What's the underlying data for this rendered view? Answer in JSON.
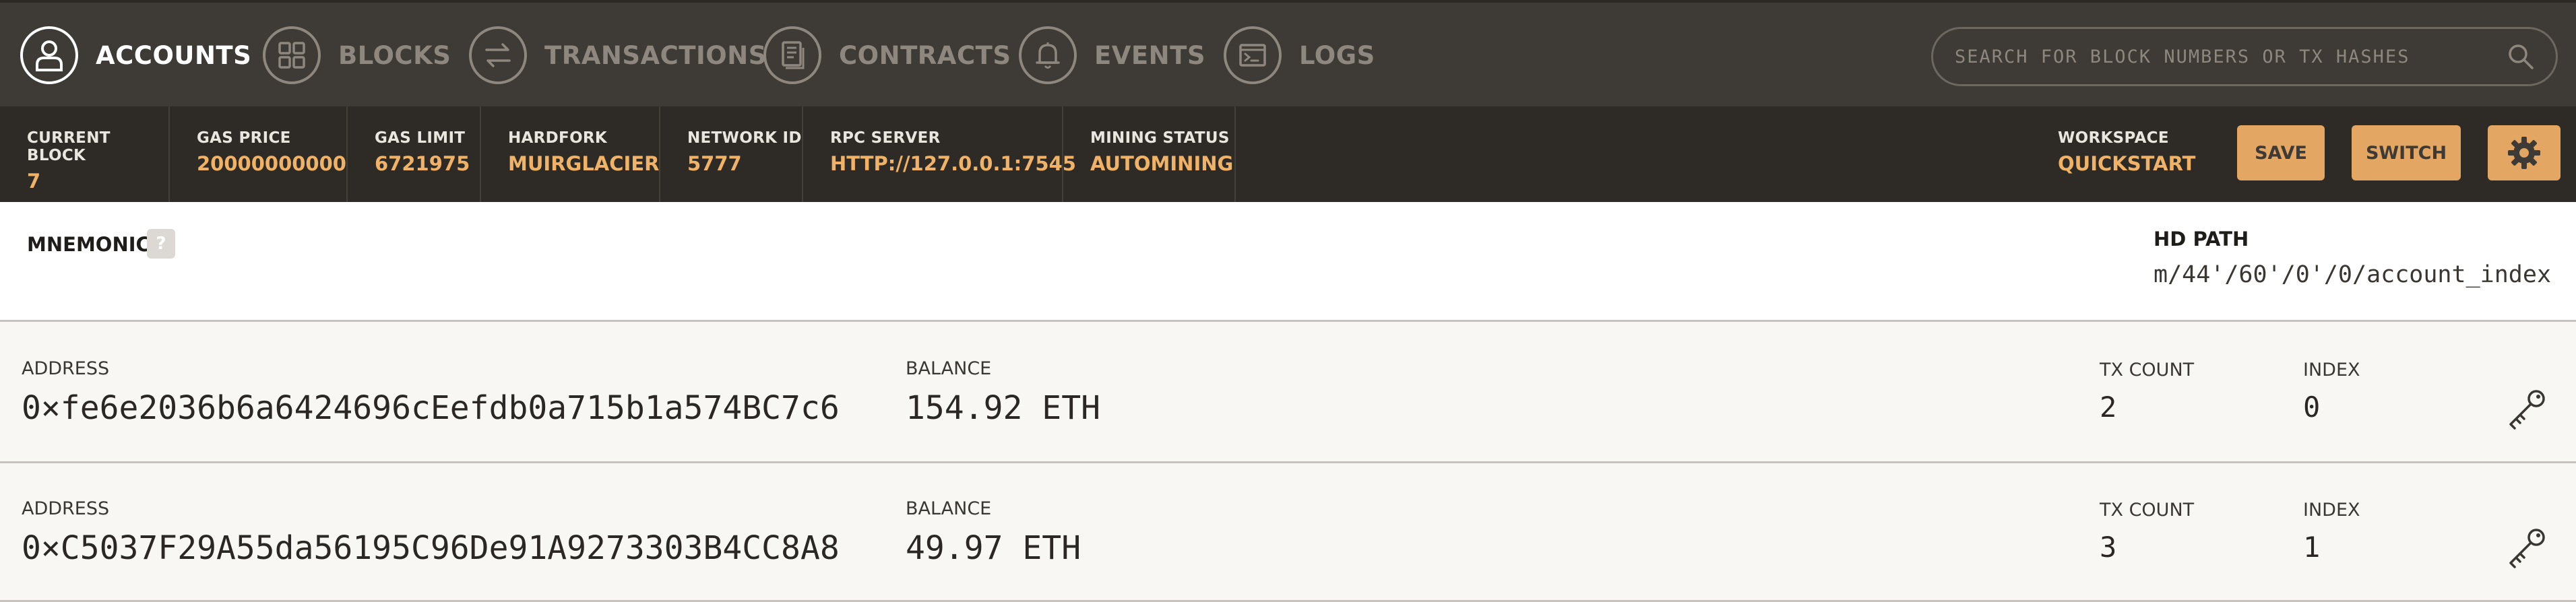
{
  "nav": {
    "items": [
      {
        "label": "ACCOUNTS",
        "icon": "user-icon",
        "active": true
      },
      {
        "label": "BLOCKS",
        "icon": "blocks-icon",
        "active": false
      },
      {
        "label": "TRANSACTIONS",
        "icon": "transfer-icon",
        "active": false
      },
      {
        "label": "CONTRACTS",
        "icon": "document-icon",
        "active": false
      },
      {
        "label": "EVENTS",
        "icon": "bell-icon",
        "active": false
      },
      {
        "label": "LOGS",
        "icon": "terminal-icon",
        "active": false
      }
    ],
    "search_placeholder": "SEARCH FOR BLOCK NUMBERS OR TX HASHES"
  },
  "status": {
    "current_block": {
      "label": "CURRENT BLOCK",
      "value": "7"
    },
    "gas_price": {
      "label": "GAS PRICE",
      "value": "20000000000"
    },
    "gas_limit": {
      "label": "GAS LIMIT",
      "value": "6721975"
    },
    "hardfork": {
      "label": "HARDFORK",
      "value": "MUIRGLACIER"
    },
    "network_id": {
      "label": "NETWORK ID",
      "value": "5777"
    },
    "rpc_server": {
      "label": "RPC SERVER",
      "value": "HTTP://127.0.0.1:7545"
    },
    "mining_status": {
      "label": "MINING STATUS",
      "value": "AUTOMINING"
    },
    "workspace": {
      "label": "WORKSPACE",
      "value": "QUICKSTART"
    },
    "save_label": "SAVE",
    "switch_label": "SWITCH"
  },
  "mnemonic": {
    "label": "MNEMONIC",
    "help": "?",
    "hd_path_label": "HD PATH",
    "hd_path_value": "m/44'/60'/0'/0/account_index"
  },
  "accounts": [
    {
      "address_label": "ADDRESS",
      "address": "0×fe6e2036b6a6424696cEefdb0a715b1a574BC7c6",
      "balance_label": "BALANCE",
      "balance": "154.92 ETH",
      "tx_count_label": "TX COUNT",
      "tx_count": "2",
      "index_label": "INDEX",
      "index": "0"
    },
    {
      "address_label": "ADDRESS",
      "address": "0×C5037F29A55da56195C96De91A9273303B4CC8A8",
      "balance_label": "BALANCE",
      "balance": "49.97 ETH",
      "tx_count_label": "TX COUNT",
      "tx_count": "3",
      "index_label": "INDEX",
      "index": "1"
    }
  ],
  "colors": {
    "nav_bg": "#3e3a35",
    "status_bg": "#2e2b27",
    "accent": "#f0b266",
    "button": "#e4a663"
  }
}
